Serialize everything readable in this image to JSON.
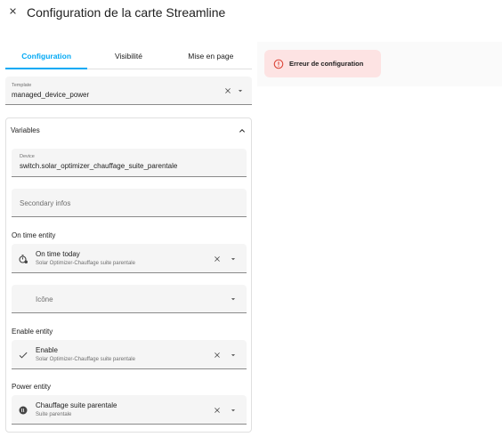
{
  "header": {
    "title": "Configuration de la carte Streamline",
    "close_icon": "close-icon"
  },
  "tabs": [
    {
      "label": "Configuration",
      "active": true
    },
    {
      "label": "Visibilité",
      "active": false
    },
    {
      "label": "Mise en page",
      "active": false
    }
  ],
  "template": {
    "label": "Template",
    "value": "managed_device_power"
  },
  "variables": {
    "title": "Variables",
    "device": {
      "label": "Device",
      "value": "switch.solar_optimizer_chauffage_suite_parentale"
    },
    "secondary_infos": {
      "placeholder": "Secondary infos"
    },
    "on_time_entity": {
      "label": "On time entity",
      "name": "On time today",
      "subtitle": "Solar Optimizer-Chauffage suite parentale",
      "icon": "timer-cog-icon"
    },
    "icone": {
      "placeholder": "Icône"
    },
    "enable_entity": {
      "label": "Enable entity",
      "name": "Enable",
      "subtitle": "Solar Optimizer-Chauffage suite parentale",
      "icon": "check-icon"
    },
    "power_entity": {
      "label": "Power entity",
      "name": "Chauffage suite parentale",
      "subtitle": "Suite parentale",
      "icon": "radiator-icon"
    }
  },
  "preview": {
    "error_text": "Erreur de configuration",
    "error_color": "#db4437"
  },
  "colors": {
    "accent": "#03a9f4",
    "error_bg": "#fde3e3",
    "field_bg": "#f5f5f5"
  }
}
